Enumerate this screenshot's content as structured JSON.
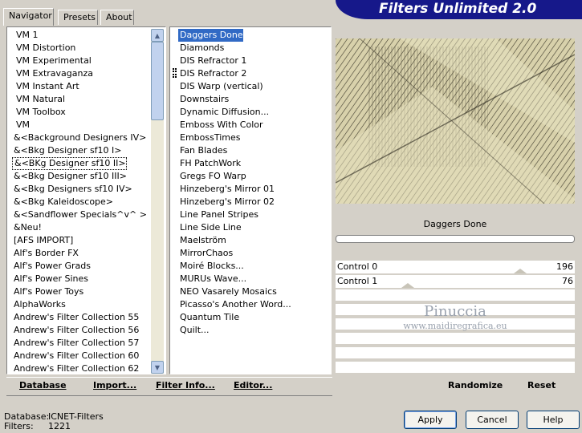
{
  "app": {
    "title": "Filters Unlimited 2.0"
  },
  "tabs": [
    {
      "label": "Navigator",
      "active": true
    },
    {
      "label": "Presets",
      "active": false
    },
    {
      "label": "About",
      "active": false
    }
  ],
  "categories": [
    "VM 1",
    "VM Distortion",
    "VM Experimental",
    "VM Extravaganza",
    "VM Instant Art",
    "VM Natural",
    "VM Toolbox",
    "VM",
    "&<Background Designers IV>",
    "&<Bkg Designer sf10 I>",
    "&<BKg Designer sf10 II>",
    "&<Bkg Designer sf10 III>",
    "&<Bkg Designers sf10 IV>",
    "&<Bkg Kaleidoscope>",
    "&<Sandflower Specials^v^ >",
    "&Neu!",
    "[AFS IMPORT]",
    "Alf's Border FX",
    "Alf's Power Grads",
    "Alf's Power Sines",
    "Alf's Power Toys",
    "AlphaWorks",
    "Andrew's Filter Collection 55",
    "Andrew's Filter Collection 56",
    "Andrew's Filter Collection 57",
    "Andrew's Filter Collection 60",
    "Andrew's Filter Collection 62"
  ],
  "selected_category": "&<BKg Designer sf10 II>",
  "filters": [
    "Daggers Done",
    "Diamonds",
    "DIS Refractor 1",
    "DIS Refractor 2",
    "DIS Warp (vertical)",
    "Downstairs",
    "Dynamic Diffusion...",
    "Emboss With Color",
    "EmbossTimes",
    "Fan Blades",
    "FH PatchWork",
    "Gregs FO Warp",
    "Hinzeberg's Mirror 01",
    "Hinzeberg's Mirror 02",
    "Line Panel Stripes",
    "Line Side Line",
    "Maelström",
    "MirrorChaos",
    "Moiré Blocks...",
    "MURUs Wave...",
    "NEO Vasarely Mosaics",
    "Picasso's Another Word...",
    "Quantum Tile",
    "Quilt..."
  ],
  "selected_filter": "Daggers Done",
  "preview": {
    "filter_name": "Daggers Done",
    "progress": 0
  },
  "controls": [
    {
      "label": "Control 0",
      "value": "196"
    },
    {
      "label": "Control  1",
      "value": "76"
    }
  ],
  "watermark": {
    "name": "Pinuccia",
    "url": "www.maidiregrafica.eu"
  },
  "bottom_links": {
    "database": "Database",
    "import": "Import...",
    "filter_info": "Filter Info...",
    "editor": "Editor...",
    "randomize": "Randomize",
    "reset": "Reset"
  },
  "status": {
    "database_label": "Database:",
    "database_value": "ICNET-Filters",
    "filters_label": "Filters:",
    "filters_value": "1221"
  },
  "buttons": {
    "apply": "Apply",
    "cancel": "Cancel",
    "help": "Help"
  },
  "colors": {
    "banner": "#16188a",
    "dialog": "#d4d0c8",
    "selection": "#316ac5",
    "preview_base": "#d6cfa8"
  }
}
